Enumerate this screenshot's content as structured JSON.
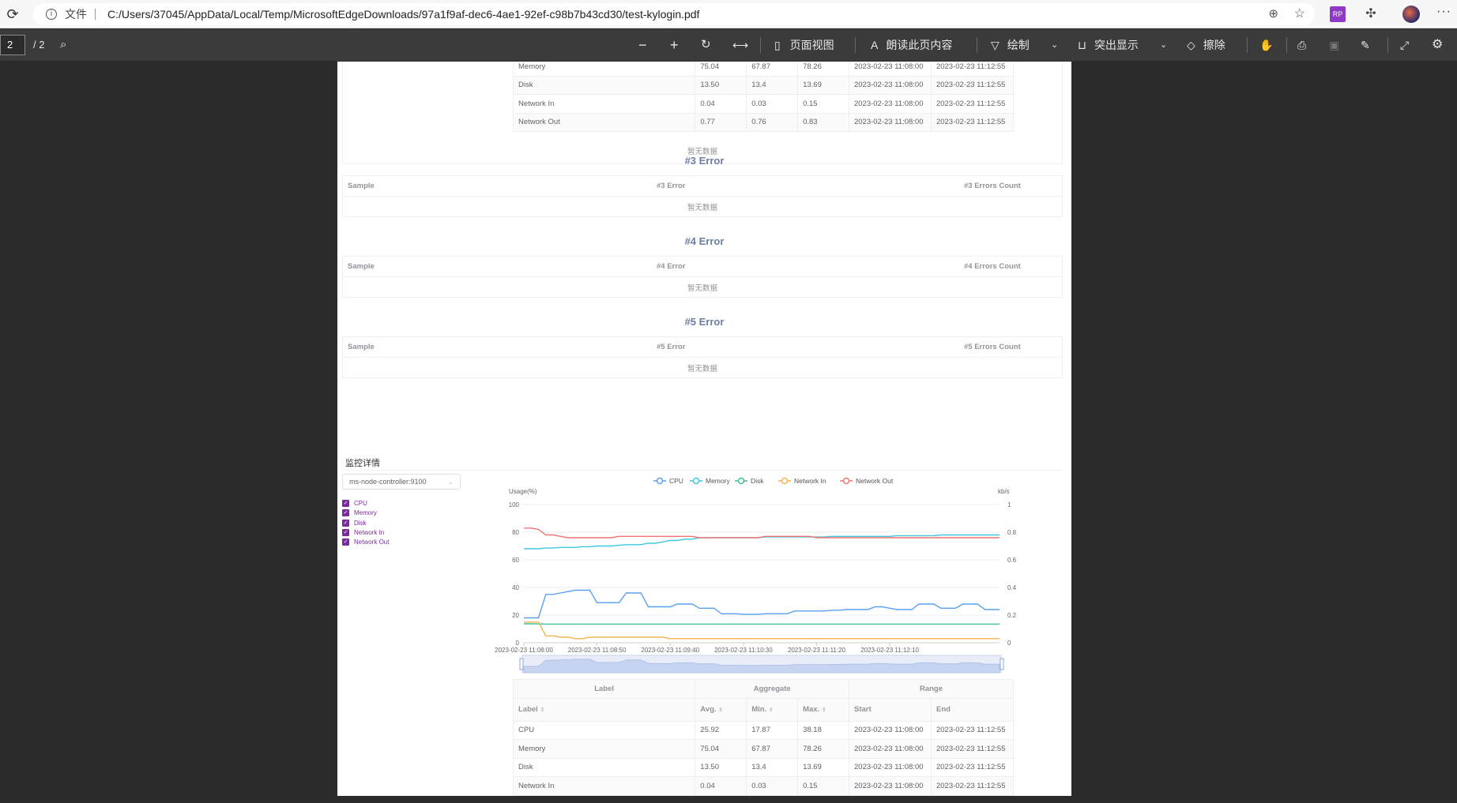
{
  "browser": {
    "file_label": "文件",
    "url": "C:/Users/37045/AppData/Local/Temp/MicrosoftEdgeDownloads/97a1f9af-dec6-4ae1-92ef-c98b7b43cd30/test-kylogin.pdf",
    "ext_label": "RP"
  },
  "pdf_toolbar": {
    "page_current": "2",
    "page_total": "/ 2",
    "page_view_label": "页面视图",
    "read_aloud_label": "朗读此页内容",
    "draw_label": "绘制",
    "highlight_label": "突出显示",
    "erase_label": "擦除"
  },
  "top_table": {
    "rows": [
      {
        "label": "Memory",
        "avg": "75.04",
        "min": "67.87",
        "max": "78.26",
        "start": "2023-02-23 11:08:00",
        "end": "2023-02-23 11:12:55"
      },
      {
        "label": "Disk",
        "avg": "13.50",
        "min": "13.4",
        "max": "13.69",
        "start": "2023-02-23 11:08:00",
        "end": "2023-02-23 11:12:55"
      },
      {
        "label": "Network In",
        "avg": "0.04",
        "min": "0.03",
        "max": "0.15",
        "start": "2023-02-23 11:08:00",
        "end": "2023-02-23 11:12:55"
      },
      {
        "label": "Network Out",
        "avg": "0.77",
        "min": "0.76",
        "max": "0.83",
        "start": "2023-02-23 11:08:00",
        "end": "2023-02-23 11:12:55"
      }
    ],
    "nodata": "暂无数据"
  },
  "errors": [
    {
      "title": "#3 Error",
      "col1": "Sample",
      "col2": "#3 Error",
      "col3": "#3 Errors Count",
      "nodata": "暂无数据"
    },
    {
      "title": "#4 Error",
      "col1": "Sample",
      "col2": "#4 Error",
      "col3": "#4 Errors Count",
      "nodata": "暂无数据"
    },
    {
      "title": "#5 Error",
      "col1": "Sample",
      "col2": "#5 Error",
      "col3": "#5 Errors Count",
      "nodata": "暂无数据"
    }
  ],
  "monitor": {
    "title": "监控详情",
    "select_value": "ms-node-controller:9100",
    "checkboxes": [
      "CPU",
      "Memory",
      "Disk",
      "Network In",
      "Network Out"
    ]
  },
  "chart_data": {
    "type": "line",
    "legend": [
      "CPU",
      "Memory",
      "Disk",
      "Network In",
      "Network Out"
    ],
    "colors": {
      "CPU": "#5aa0f0",
      "Memory": "#3fc8e0",
      "Disk": "#3fbf9a",
      "Network In": "#f4b350",
      "Network Out": "#f07474"
    },
    "ylabel_left": "Usage(%)",
    "ylabel_right": "kb/s",
    "ylim_left": [
      0,
      100
    ],
    "ylim_right": [
      0,
      1
    ],
    "yticks_left": [
      "0",
      "20",
      "40",
      "60",
      "80",
      "100"
    ],
    "yticks_right": [
      "0",
      "0.2",
      "0.4",
      "0.6",
      "0.8",
      "1"
    ],
    "xticks": [
      "2023-02-23 11:08:00",
      "2023-02-23 11:08:50",
      "2023-02-23 11:09:40",
      "2023-02-23 11:10:30",
      "2023-02-23 11:11:20",
      "2023-02-23 11:12:10"
    ],
    "series": [
      {
        "name": "CPU",
        "axis": "left",
        "values": [
          18,
          18,
          18,
          35,
          35,
          36,
          37,
          38,
          38,
          38,
          29,
          29,
          29,
          29,
          36,
          36,
          36,
          26,
          26,
          26,
          26,
          28,
          28,
          28,
          25,
          25,
          25,
          21,
          21,
          21,
          20.5,
          20.5,
          20.5,
          21,
          21,
          21,
          21,
          23,
          23,
          23,
          23,
          23,
          23.5,
          23.5,
          24,
          24,
          24,
          24,
          26,
          26,
          25,
          24,
          24,
          24,
          28,
          28,
          28,
          25,
          25,
          25,
          28,
          28,
          28,
          24,
          24,
          24
        ]
      },
      {
        "name": "Memory",
        "axis": "left",
        "values": [
          68,
          68,
          68,
          68.5,
          68.5,
          69,
          69,
          69,
          69.5,
          69.5,
          70,
          70,
          70,
          70.5,
          71,
          71,
          71,
          72,
          72,
          73,
          74,
          74,
          75,
          75,
          76,
          76,
          76,
          76,
          76,
          76,
          76,
          76,
          76,
          76.5,
          76.5,
          76.5,
          76.5,
          76.5,
          76.5,
          76.5,
          76.5,
          76.5,
          77,
          77,
          77,
          77,
          77,
          77,
          77,
          77,
          77,
          77.5,
          77.5,
          77.5,
          77.5,
          77.5,
          77.5,
          78,
          78,
          78,
          78,
          78,
          78,
          78,
          78,
          78
        ]
      },
      {
        "name": "Disk",
        "axis": "left",
        "values": [
          13.7,
          13.7,
          13.6,
          13.5,
          13.5,
          13.5,
          13.5,
          13.5,
          13.5,
          13.5,
          13.5,
          13.5,
          13.5,
          13.5,
          13.5,
          13.5,
          13.5,
          13.5,
          13.5,
          13.5,
          13.5,
          13.5,
          13.5,
          13.5,
          13.5,
          13.5,
          13.5,
          13.5,
          13.5,
          13.5,
          13.5,
          13.5,
          13.5,
          13.5,
          13.5,
          13.5,
          13.5,
          13.5,
          13.5,
          13.5,
          13.5,
          13.5,
          13.5,
          13.5,
          13.5,
          13.5,
          13.5,
          13.5,
          13.5,
          13.5,
          13.5,
          13.5,
          13.5,
          13.5,
          13.5,
          13.5,
          13.5,
          13.5,
          13.5,
          13.5,
          13.5,
          13.5,
          13.5,
          13.5,
          13.5,
          13.5
        ]
      },
      {
        "name": "Network In",
        "axis": "right",
        "values": [
          0.15,
          0.15,
          0.15,
          0.05,
          0.05,
          0.04,
          0.04,
          0.03,
          0.03,
          0.04,
          0.04,
          0.04,
          0.04,
          0.04,
          0.04,
          0.04,
          0.04,
          0.04,
          0.04,
          0.04,
          0.03,
          0.03,
          0.03,
          0.03,
          0.03,
          0.03,
          0.03,
          0.03,
          0.03,
          0.03,
          0.03,
          0.03,
          0.03,
          0.03,
          0.03,
          0.03,
          0.03,
          0.03,
          0.03,
          0.03,
          0.03,
          0.03,
          0.03,
          0.03,
          0.03,
          0.03,
          0.03,
          0.03,
          0.03,
          0.03,
          0.03,
          0.03,
          0.03,
          0.03,
          0.03,
          0.03,
          0.03,
          0.03,
          0.03,
          0.03,
          0.03,
          0.03,
          0.03,
          0.03,
          0.03,
          0.03
        ]
      },
      {
        "name": "Network Out",
        "axis": "right",
        "values": [
          0.83,
          0.83,
          0.82,
          0.78,
          0.78,
          0.77,
          0.76,
          0.76,
          0.76,
          0.76,
          0.76,
          0.76,
          0.76,
          0.77,
          0.77,
          0.77,
          0.77,
          0.77,
          0.77,
          0.77,
          0.77,
          0.77,
          0.77,
          0.77,
          0.76,
          0.76,
          0.76,
          0.76,
          0.76,
          0.76,
          0.76,
          0.76,
          0.76,
          0.77,
          0.77,
          0.77,
          0.77,
          0.77,
          0.77,
          0.77,
          0.76,
          0.76,
          0.76,
          0.76,
          0.76,
          0.76,
          0.76,
          0.76,
          0.76,
          0.76,
          0.76,
          0.76,
          0.76,
          0.76,
          0.76,
          0.76,
          0.76,
          0.76,
          0.76,
          0.76,
          0.76,
          0.76,
          0.76,
          0.76,
          0.76,
          0.76
        ]
      }
    ]
  },
  "bottom_table": {
    "group_headers": [
      "Label",
      "Aggregate",
      "Range"
    ],
    "col_headers": [
      "Label",
      "Avg.",
      "Min.",
      "Max.",
      "Start",
      "End"
    ],
    "rows": [
      {
        "label": "CPU",
        "avg": "25.92",
        "min": "17.87",
        "max": "38.18",
        "start": "2023-02-23 11:08:00",
        "end": "2023-02-23 11:12:55"
      },
      {
        "label": "Memory",
        "avg": "75.04",
        "min": "67.87",
        "max": "78.26",
        "start": "2023-02-23 11:08:00",
        "end": "2023-02-23 11:12:55"
      },
      {
        "label": "Disk",
        "avg": "13.50",
        "min": "13.4",
        "max": "13.69",
        "start": "2023-02-23 11:08:00",
        "end": "2023-02-23 11:12:55"
      },
      {
        "label": "Network In",
        "avg": "0.04",
        "min": "0.03",
        "max": "0.15",
        "start": "2023-02-23 11:08:00",
        "end": "2023-02-23 11:12:55"
      }
    ]
  }
}
